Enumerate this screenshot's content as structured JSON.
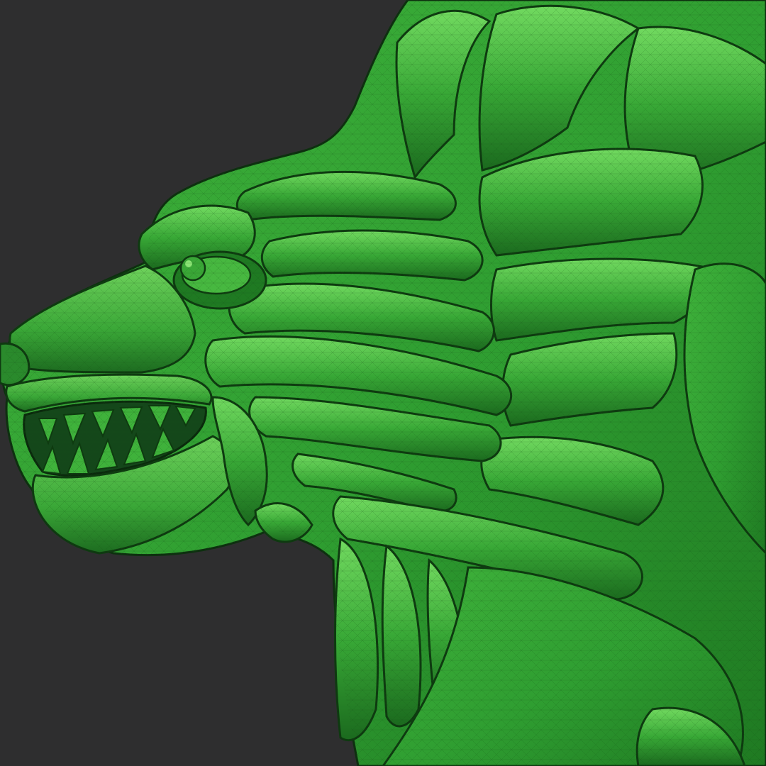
{
  "scene": {
    "subject": "sculpted-wolf-head-relief",
    "facing": "left",
    "colors": {
      "background": "#2e2e2f",
      "mesh_base": "#2f9e31",
      "mesh_light": "#5fd055",
      "mesh_highlight": "#8ae474",
      "mesh_dark": "#1a5f1c",
      "mesh_shadow": "#0e3a10",
      "mouth_interior": "#14471a",
      "wireframe": "#164d18"
    }
  }
}
